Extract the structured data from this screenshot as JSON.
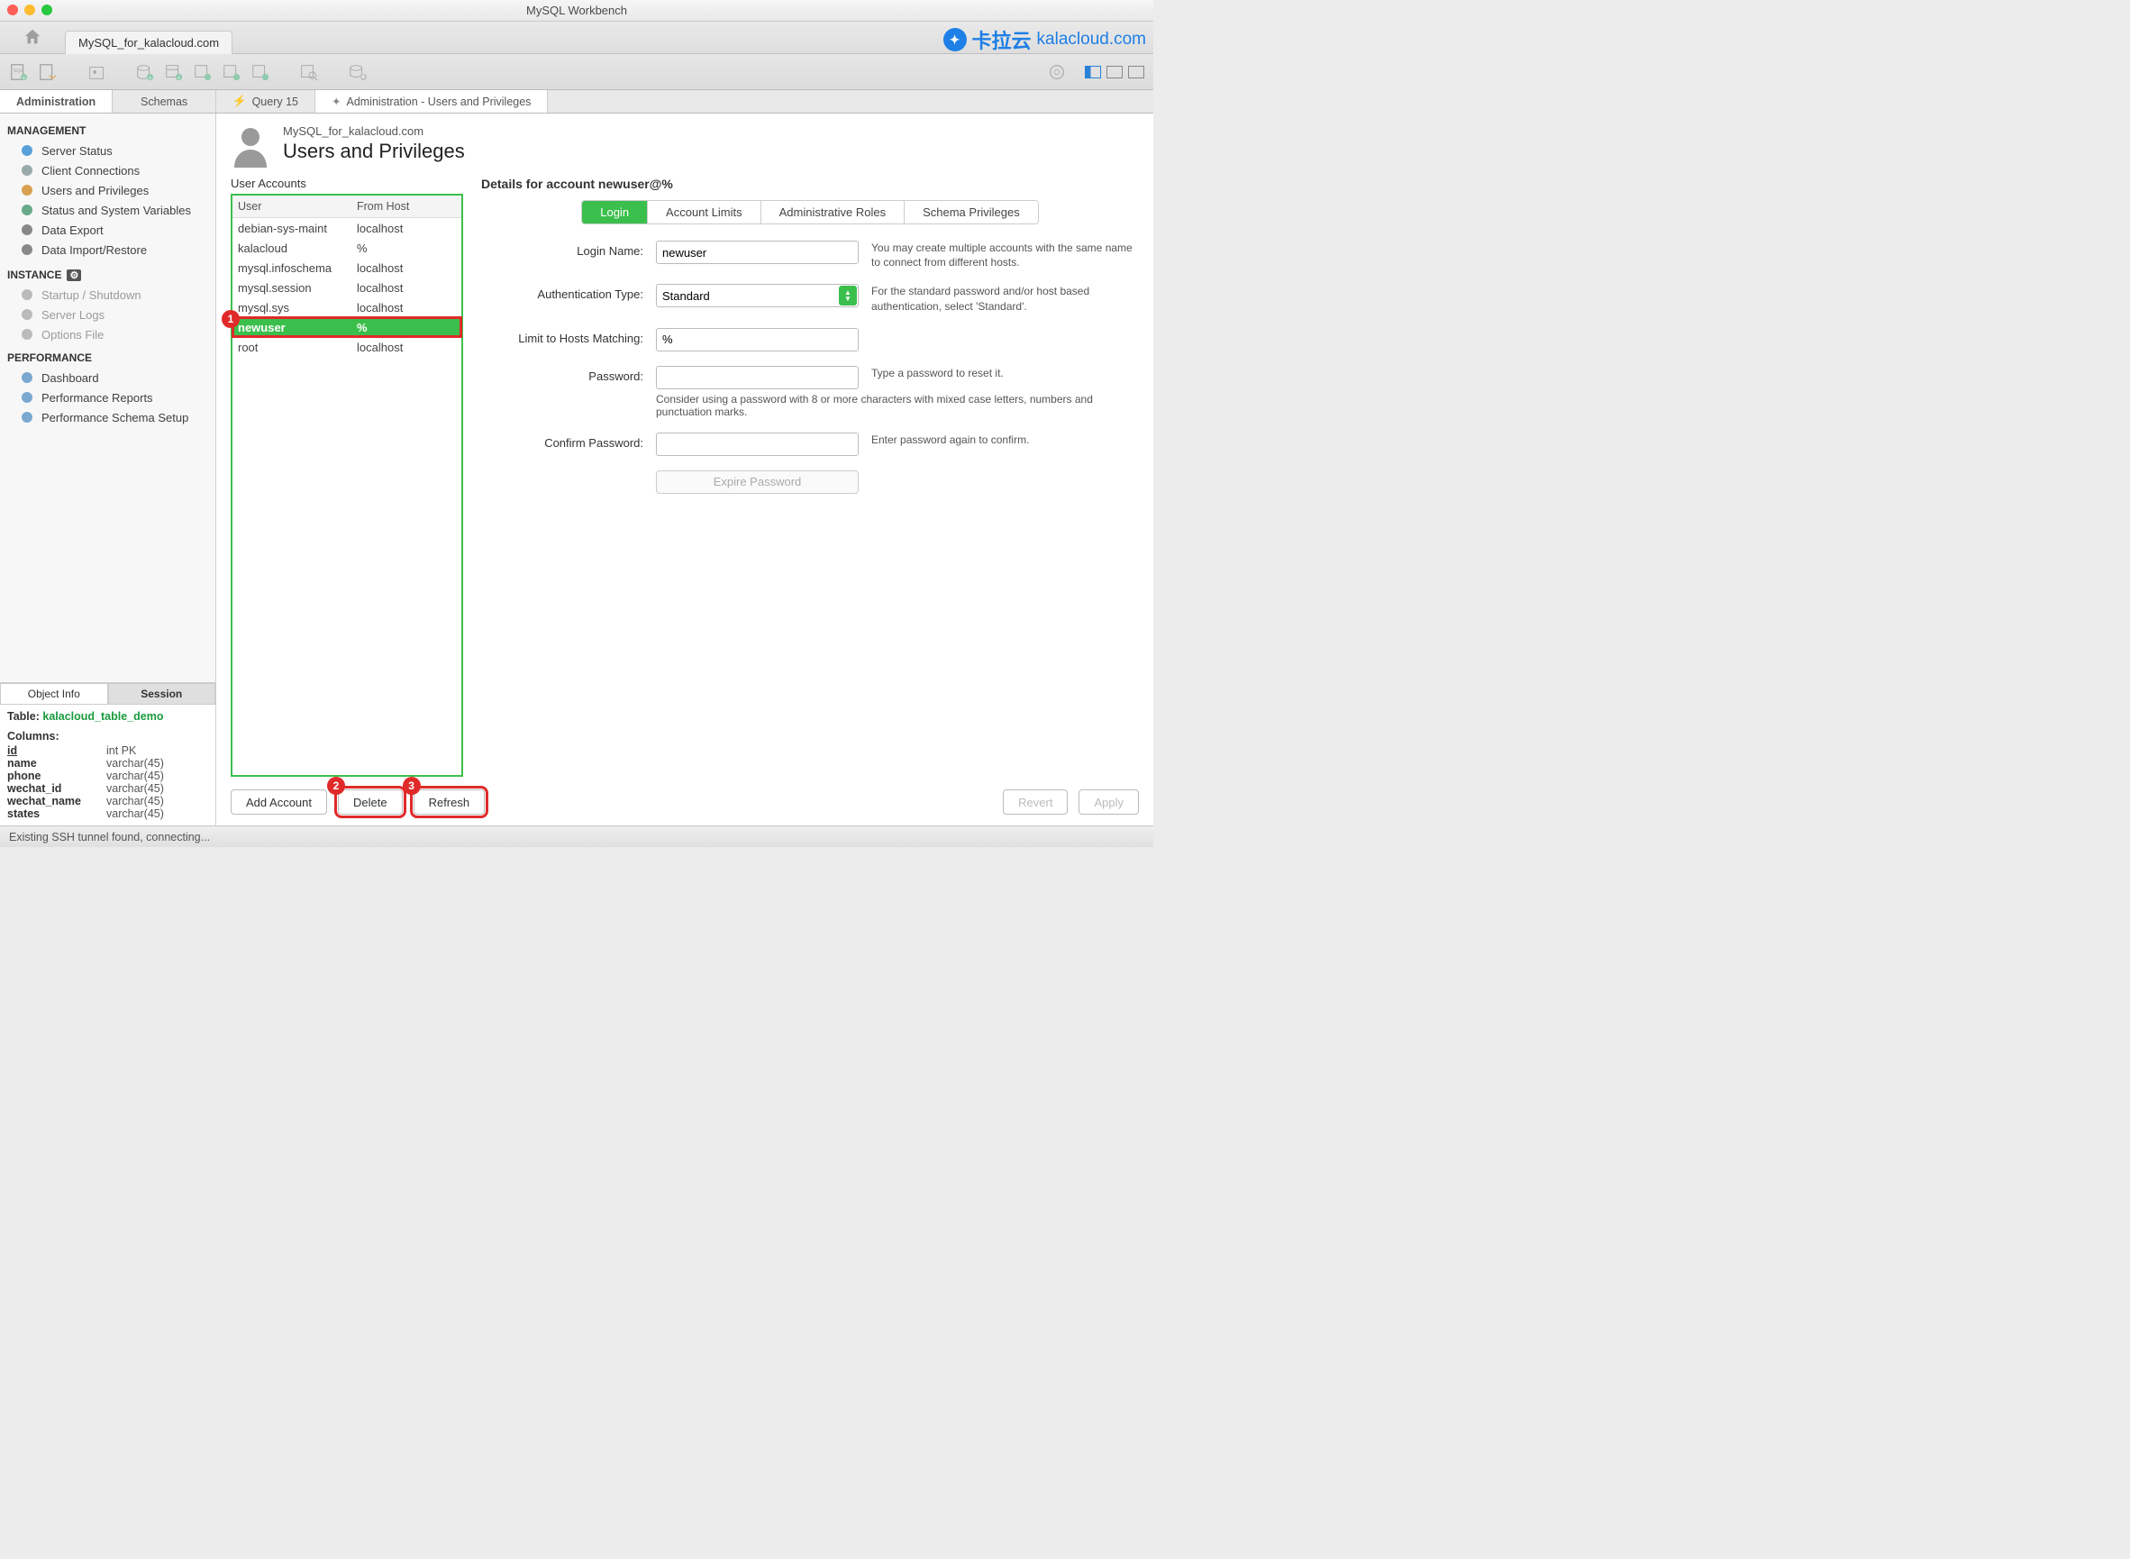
{
  "window_title": "MySQL Workbench",
  "connection_tab": "MySQL_for_kalacloud.com",
  "content_tabs": {
    "sidebar_admin": "Administration",
    "sidebar_schemas": "Schemas",
    "t_query": "Query 15",
    "t_admin": "Administration - Users and Privileges"
  },
  "management": {
    "heading": "MANAGEMENT",
    "items": [
      "Server Status",
      "Client Connections",
      "Users and Privileges",
      "Status and System Variables",
      "Data Export",
      "Data Import/Restore"
    ]
  },
  "instance": {
    "heading": "INSTANCE",
    "items": [
      "Startup / Shutdown",
      "Server Logs",
      "Options File"
    ]
  },
  "performance": {
    "heading": "PERFORMANCE",
    "items": [
      "Dashboard",
      "Performance Reports",
      "Performance Schema Setup"
    ]
  },
  "objinfo": {
    "tab1": "Object Info",
    "tab2": "Session",
    "table_label": "Table:",
    "table_name": "kalacloud_table_demo",
    "cols_h": "Columns:",
    "cols": [
      {
        "n": "id",
        "t": "int PK",
        "u": true
      },
      {
        "n": "name",
        "t": "varchar(45)"
      },
      {
        "n": "phone",
        "t": "varchar(45)"
      },
      {
        "n": "wechat_id",
        "t": "varchar(45)"
      },
      {
        "n": "wechat_name",
        "t": "varchar(45)"
      },
      {
        "n": "states",
        "t": "varchar(45)"
      }
    ]
  },
  "page": {
    "caption": "MySQL_for_kalacloud.com",
    "title": "Users and Privileges"
  },
  "accounts": {
    "label": "User Accounts",
    "col_user": "User",
    "col_host": "From Host",
    "rows": [
      {
        "u": "debian-sys-maint",
        "h": "localhost"
      },
      {
        "u": "kalacloud",
        "h": "%"
      },
      {
        "u": "mysql.infoschema",
        "h": "localhost"
      },
      {
        "u": "mysql.session",
        "h": "localhost"
      },
      {
        "u": "mysql.sys",
        "h": "localhost"
      },
      {
        "u": "newuser",
        "h": "%",
        "sel": true
      },
      {
        "u": "root",
        "h": "localhost"
      }
    ]
  },
  "details": {
    "title": "Details for account newuser@%",
    "tabs": [
      "Login",
      "Account Limits",
      "Administrative Roles",
      "Schema Privileges"
    ],
    "login_name_l": "Login Name:",
    "login_name_v": "newuser",
    "login_name_h": "You may create multiple accounts with the same name to connect from different hosts.",
    "auth_l": "Authentication Type:",
    "auth_v": "Standard",
    "auth_h": "For the standard password and/or host based authentication, select 'Standard'.",
    "hosts_l": "Limit to Hosts Matching:",
    "hosts_v": "%",
    "pass_l": "Password:",
    "pass_h": "Type a password to reset it.",
    "pass_sub": "Consider using a password with 8 or more characters with mixed case letters, numbers and punctuation marks.",
    "cpass_l": "Confirm Password:",
    "cpass_h": "Enter password again to confirm.",
    "expire": "Expire Password"
  },
  "buttons": {
    "add": "Add Account",
    "del": "Delete",
    "refresh": "Refresh",
    "revert": "Revert",
    "apply": "Apply"
  },
  "markers": {
    "m1": "1",
    "m2": "2",
    "m3": "3"
  },
  "status": "Existing SSH tunnel found, connecting...",
  "watermark": {
    "cn": "卡拉云",
    "en": "kalacloud.com"
  }
}
